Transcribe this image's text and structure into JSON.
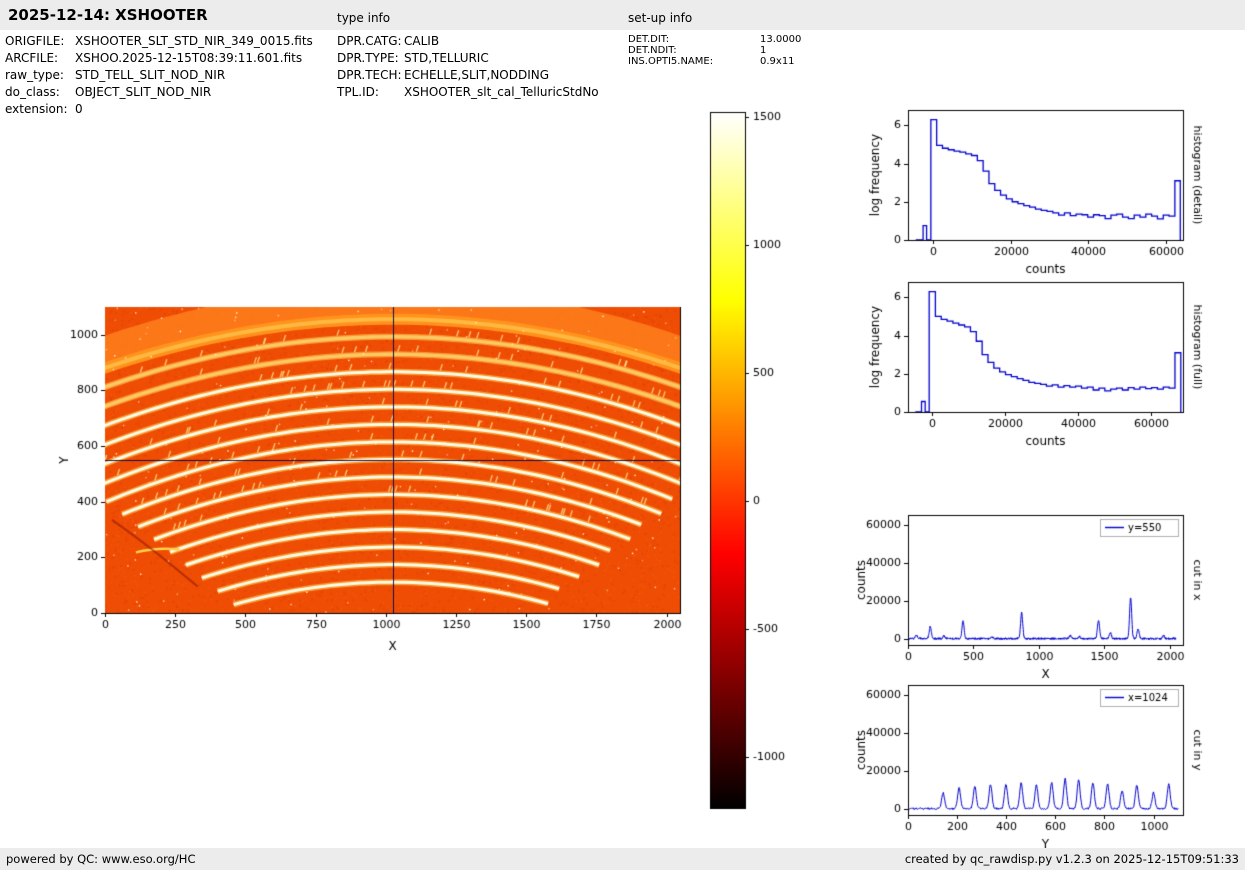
{
  "header": {
    "title": "2025-12-14: XSHOOTER",
    "type_info_title": "type info",
    "setup_info_title": "set-up info"
  },
  "file_info": {
    "rows": [
      {
        "label": "ORIGFILE:",
        "value": "XSHOOTER_SLT_STD_NIR_349_0015.fits"
      },
      {
        "label": "ARCFILE:",
        "value": "XSHOO.2025-12-15T08:39:11.601.fits"
      },
      {
        "label": "raw_type:",
        "value": "STD_TELL_SLIT_NOD_NIR"
      },
      {
        "label": "do_class:",
        "value": "OBJECT_SLIT_NOD_NIR"
      },
      {
        "label": "extension:",
        "value": "0"
      }
    ]
  },
  "type_info": {
    "rows": [
      {
        "label": "DPR.CATG:",
        "value": "CALIB"
      },
      {
        "label": "DPR.TYPE:",
        "value": "STD,TELLURIC"
      },
      {
        "label": "DPR.TECH:",
        "value": "ECHELLE,SLIT,NODDING"
      },
      {
        "label": "TPL.ID:",
        "value": "XSHOOTER_slt_cal_TelluricStdNo"
      }
    ]
  },
  "setup_info": {
    "rows": [
      {
        "label": "DET.DIT:",
        "value": "13.0000"
      },
      {
        "label": "DET.NDIT:",
        "value": "1"
      },
      {
        "label": "INS.OPTI5.NAME:",
        "value": "0.9x11"
      }
    ]
  },
  "footer": {
    "left": "powered by QC: www.eso.org/HC",
    "right": "created by qc_rawdisp.py v1.2.3 on 2025-12-15T09:51:33"
  },
  "colors": {
    "line_blue": "#0000cd",
    "bar_gray": "#ececec",
    "image_background": "#ef4d04"
  },
  "chart_data": [
    {
      "id": "raw_image",
      "type": "heatmap",
      "xlabel": "X",
      "ylabel": "Y",
      "xlim": [
        0,
        2048
      ],
      "ylim": [
        0,
        1100
      ],
      "xticks": [
        0,
        250,
        500,
        750,
        1000,
        1250,
        1500,
        1750,
        2000
      ],
      "yticks": [
        0,
        200,
        400,
        600,
        800,
        1000
      ],
      "crosshair_x": 1024,
      "crosshair_y": 550,
      "description": "XSHOOTER NIR raw echelle frame: 16 upward-arching bright spectral orders on orange background, hot colormap, crosshair at x=1024 y=550",
      "orders": {
        "count": 16,
        "apex_start": 1056,
        "apex_step": 63,
        "sag_base": 175,
        "sag_step": 6
      },
      "colorbar": {
        "colormap": "hot",
        "vmin": -1200,
        "vmax": 1520,
        "ticks": [
          1500,
          1000,
          500,
          0,
          -500,
          -1000
        ]
      }
    },
    {
      "id": "hist_detail",
      "type": "line",
      "style": "step",
      "xlabel": "counts",
      "ylabel": "log frequency",
      "right_label": "histogram (detail)",
      "xlim": [
        -6500,
        64500
      ],
      "ylim": [
        0,
        6.8
      ],
      "xticks": [
        0,
        20000,
        40000,
        60000
      ],
      "yticks": [
        0,
        2,
        4,
        6
      ],
      "steps": [
        [
          -4500,
          0
        ],
        [
          -2600,
          0.75
        ],
        [
          -1700,
          0
        ],
        [
          -600,
          6.3
        ],
        [
          900,
          4.95
        ],
        [
          2400,
          4.8
        ],
        [
          3900,
          4.72
        ],
        [
          5400,
          4.65
        ],
        [
          6900,
          4.6
        ],
        [
          8400,
          4.5
        ],
        [
          9900,
          4.42
        ],
        [
          11400,
          4.15
        ],
        [
          12900,
          3.6
        ],
        [
          14400,
          2.95
        ],
        [
          15900,
          2.6
        ],
        [
          17400,
          2.35
        ],
        [
          18900,
          2.15
        ],
        [
          20400,
          2.0
        ],
        [
          21900,
          1.9
        ],
        [
          23400,
          1.8
        ],
        [
          24900,
          1.72
        ],
        [
          26400,
          1.62
        ],
        [
          27900,
          1.55
        ],
        [
          29400,
          1.5
        ],
        [
          30900,
          1.42
        ],
        [
          32400,
          1.3
        ],
        [
          33900,
          1.42
        ],
        [
          35400,
          1.28
        ],
        [
          36900,
          1.35
        ],
        [
          38400,
          1.32
        ],
        [
          39900,
          1.2
        ],
        [
          41400,
          1.32
        ],
        [
          42900,
          1.28
        ],
        [
          44400,
          1.12
        ],
        [
          45900,
          1.3
        ],
        [
          47400,
          1.35
        ],
        [
          48900,
          1.2
        ],
        [
          50400,
          1.12
        ],
        [
          51900,
          1.3
        ],
        [
          53400,
          1.2
        ],
        [
          54900,
          1.35
        ],
        [
          56400,
          1.25
        ],
        [
          57900,
          1.1
        ],
        [
          59400,
          1.3
        ],
        [
          60900,
          1.25
        ],
        [
          62400,
          3.1
        ],
        [
          63800,
          0
        ]
      ]
    },
    {
      "id": "hist_full",
      "type": "line",
      "style": "step",
      "xlabel": "counts",
      "ylabel": "log frequency",
      "right_label": "histogram (full)",
      "xlim": [
        -6500,
        68800
      ],
      "ylim": [
        0,
        6.8
      ],
      "xticks": [
        0,
        20000,
        40000,
        60000
      ],
      "yticks": [
        0,
        2,
        4,
        6
      ],
      "steps": [
        [
          -4500,
          0
        ],
        [
          -2800,
          0.55
        ],
        [
          -1800,
          0
        ],
        [
          -700,
          6.3
        ],
        [
          1000,
          5.0
        ],
        [
          2600,
          4.85
        ],
        [
          4200,
          4.75
        ],
        [
          5800,
          4.65
        ],
        [
          7400,
          4.55
        ],
        [
          9000,
          4.45
        ],
        [
          10600,
          4.2
        ],
        [
          12200,
          3.7
        ],
        [
          13800,
          3.0
        ],
        [
          15400,
          2.6
        ],
        [
          17000,
          2.3
        ],
        [
          18600,
          2.1
        ],
        [
          20200,
          1.95
        ],
        [
          21800,
          1.85
        ],
        [
          23400,
          1.75
        ],
        [
          25000,
          1.65
        ],
        [
          26600,
          1.55
        ],
        [
          28200,
          1.5
        ],
        [
          29800,
          1.45
        ],
        [
          31400,
          1.35
        ],
        [
          33000,
          1.42
        ],
        [
          34600,
          1.3
        ],
        [
          36200,
          1.38
        ],
        [
          37800,
          1.3
        ],
        [
          39400,
          1.35
        ],
        [
          41000,
          1.25
        ],
        [
          42600,
          1.3
        ],
        [
          44200,
          1.15
        ],
        [
          45800,
          1.25
        ],
        [
          47400,
          1.1
        ],
        [
          49000,
          1.2
        ],
        [
          50600,
          1.25
        ],
        [
          52200,
          1.15
        ],
        [
          53800,
          1.28
        ],
        [
          55400,
          1.2
        ],
        [
          57000,
          1.3
        ],
        [
          58600,
          1.22
        ],
        [
          60200,
          1.28
        ],
        [
          61800,
          1.2
        ],
        [
          63400,
          1.3
        ],
        [
          65000,
          1.25
        ],
        [
          66600,
          3.1
        ],
        [
          68200,
          0
        ]
      ]
    },
    {
      "id": "cut_x",
      "type": "line",
      "legend": "y=550",
      "xlabel": "X",
      "ylabel": "counts",
      "right_label": "cut in x",
      "xlim": [
        0,
        2100
      ],
      "ylim": [
        -3000,
        65000
      ],
      "xticks": [
        0,
        500,
        1000,
        1500,
        2000
      ],
      "yticks": [
        0,
        20000,
        40000,
        60000
      ],
      "baseline": 350,
      "noise": 500,
      "peak_width": 8,
      "data_range": [
        0,
        2048
      ],
      "peaks": [
        [
          65,
          1700
        ],
        [
          170,
          6300
        ],
        [
          275,
          1400
        ],
        [
          420,
          9200
        ],
        [
          640,
          1100
        ],
        [
          868,
          13500
        ],
        [
          1240,
          1700
        ],
        [
          1310,
          1100
        ],
        [
          1455,
          9800
        ],
        [
          1545,
          3100
        ],
        [
          1700,
          21500
        ],
        [
          1757,
          5200
        ],
        [
          1952,
          1500
        ]
      ]
    },
    {
      "id": "cut_y",
      "type": "line",
      "legend": "x=1024",
      "xlabel": "Y",
      "ylabel": "counts",
      "right_label": "cut in y",
      "xlim": [
        0,
        1120
      ],
      "ylim": [
        -3000,
        65000
      ],
      "xticks": [
        0,
        200,
        400,
        600,
        800,
        1000
      ],
      "yticks": [
        0,
        20000,
        40000,
        60000
      ],
      "baseline": 350,
      "noise": 500,
      "peak_width": 6,
      "data_range": [
        0,
        1100
      ],
      "peaks": [
        [
          143,
          8200
        ],
        [
          208,
          10800
        ],
        [
          272,
          11500
        ],
        [
          336,
          12400
        ],
        [
          399,
          12800
        ],
        [
          461,
          13400
        ],
        [
          523,
          12400
        ],
        [
          585,
          13800
        ],
        [
          640,
          15600
        ],
        [
          695,
          15100
        ],
        [
          753,
          13400
        ],
        [
          813,
          12800
        ],
        [
          872,
          9400
        ],
        [
          932,
          12300
        ],
        [
          1000,
          8400
        ],
        [
          1062,
          12800
        ]
      ]
    }
  ]
}
